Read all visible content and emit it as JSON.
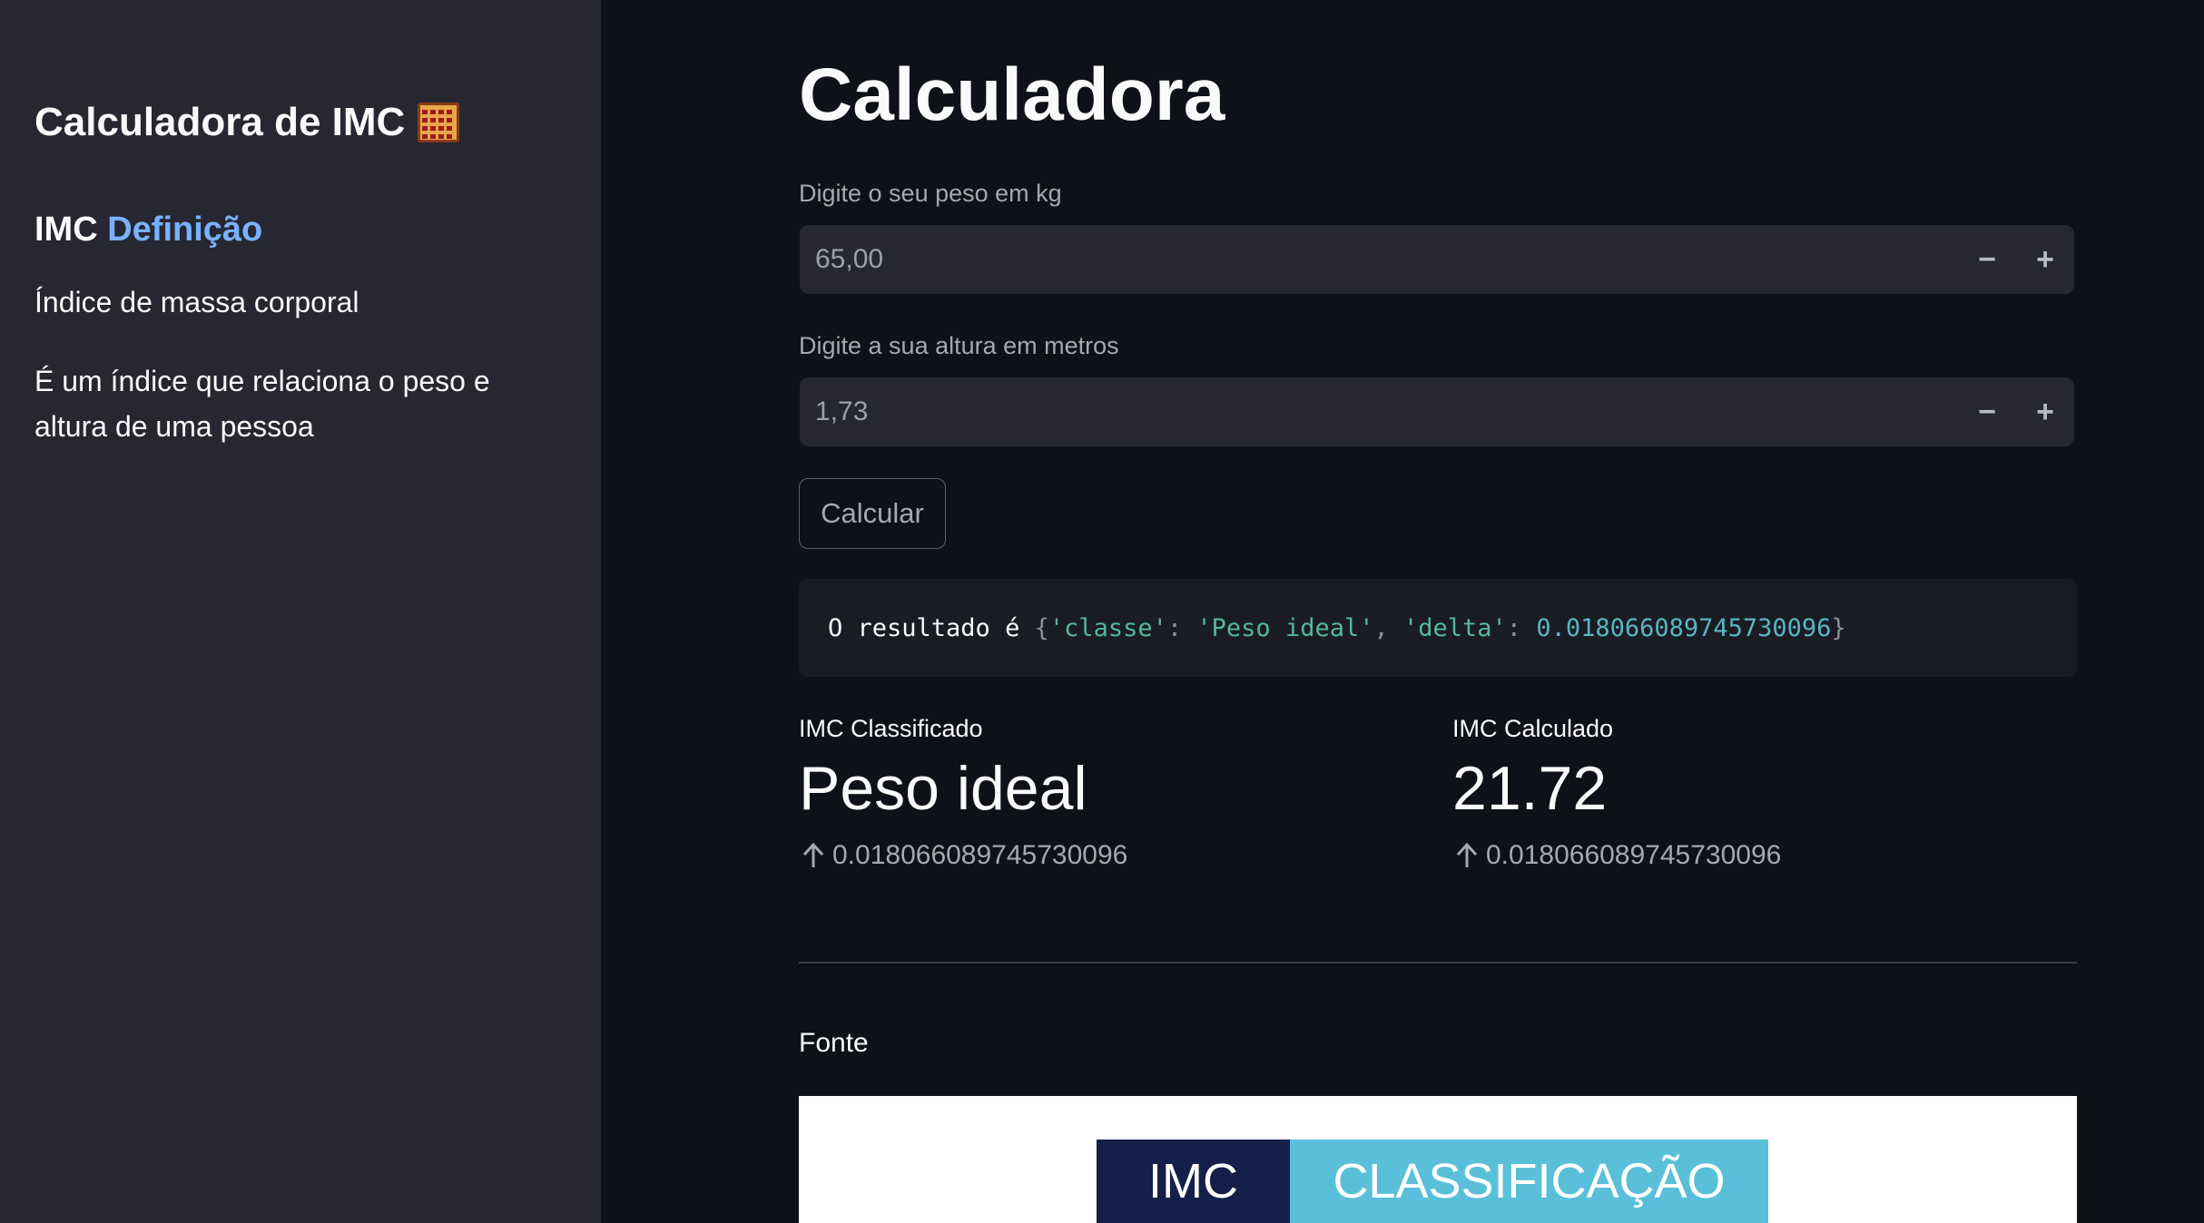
{
  "sidebar": {
    "title": "Calculadora de IMC",
    "title_icon": "abacus-icon",
    "subheader_prefix": "IMC",
    "subheader_link": "Definição",
    "subheader_link_color": "#79b1ff",
    "p1": "Índice de massa corporal",
    "p2": "É um índice que relaciona o peso e altura de uma pessoa"
  },
  "main": {
    "title": "Calculadora",
    "weight": {
      "label": "Digite o seu peso em kg",
      "value": "65,00"
    },
    "height": {
      "label": "Digite a sua altura em metros",
      "value": "1,73"
    },
    "stepper": {
      "minus": "−",
      "plus": "+"
    },
    "calc_button": "Calcular",
    "result": {
      "prefix": "O resultado é ",
      "open": "{",
      "key1": "'classe'",
      "sep": ": ",
      "val1": "'Peso ideal'",
      "comma": ", ",
      "key2": "'delta'",
      "val2": "0.018066089745730096",
      "close": "}"
    },
    "metrics": [
      {
        "label": "IMC Classificado",
        "value": "Peso ideal",
        "delta": "0.018066089745730096"
      },
      {
        "label": "IMC Calculado",
        "value": "21.72",
        "delta": "0.018066089745730096"
      }
    ],
    "source_label": "Fonte",
    "image_banner": {
      "left": "IMC",
      "right": "CLASSIFICAÇÃO"
    }
  }
}
